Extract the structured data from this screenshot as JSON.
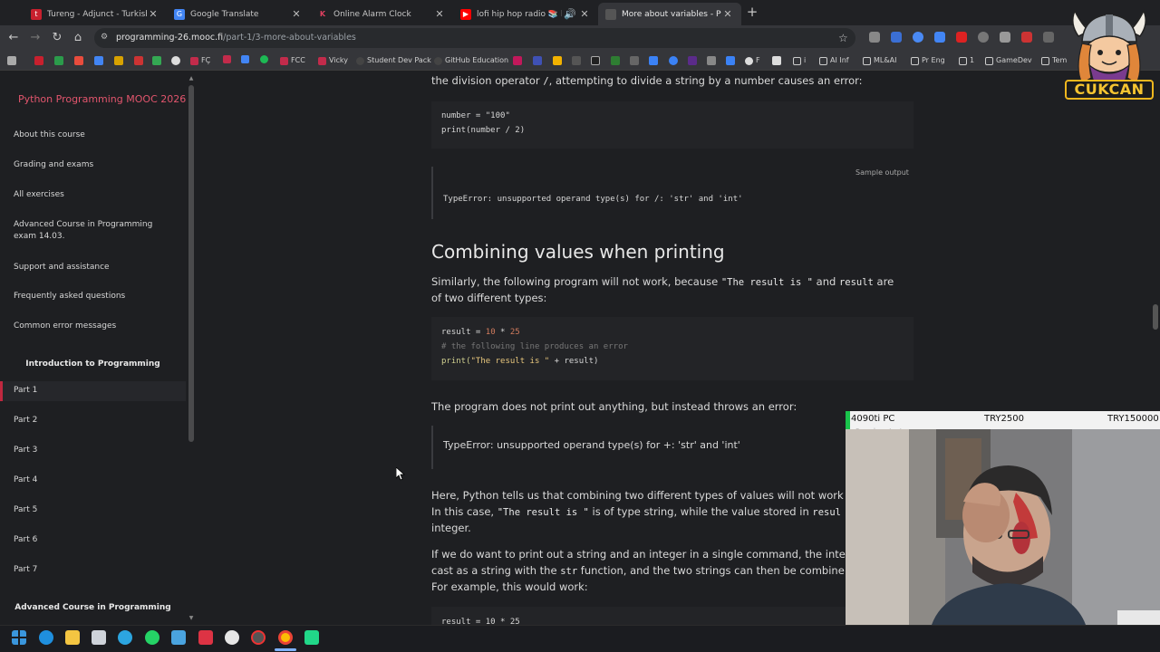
{
  "browser": {
    "tabs": [
      {
        "title": "Tureng - Adjunct - Turkish Eng",
        "color": "#c8202e",
        "icon": "tureng-icon"
      },
      {
        "title": "Google Translate",
        "color": "#4285f4",
        "icon": "translate-icon"
      },
      {
        "title": "Online Alarm Clock",
        "color": "#c22b4b",
        "icon": "alarm-k-icon"
      },
      {
        "title": "lofi hip hop radio 📚 beats",
        "color": "#ff0000",
        "icon": "youtube-icon"
      },
      {
        "title": "More about variables - Python",
        "color": "#444",
        "icon": "mooc-icon"
      }
    ],
    "url_host": "programming-26.mooc.fi",
    "url_path": "/part-1/3-more-about-variables",
    "bookmarks": [
      "FÇ",
      "FCC",
      "Vicky",
      "Student Dev Pack",
      "GitHub Education",
      "F",
      "i",
      "AI Inf",
      "ML&AI",
      "Pr Eng",
      "1",
      "GameDev",
      "Tem"
    ]
  },
  "sidebar": {
    "title": "Python Programming MOOC 2026",
    "items": [
      "About this course",
      "Grading and exams",
      "All exercises",
      "Advanced Course in Programming exam 14.03.",
      "Support and assistance",
      "Frequently asked questions",
      "Common error messages"
    ],
    "section_intro": "Introduction to Programming",
    "parts": [
      "Part 1",
      "Part 2",
      "Part 3",
      "Part 4",
      "Part 5",
      "Part 6",
      "Part 7"
    ],
    "section_advanced": "Advanced Course in Programming"
  },
  "content": {
    "intro_line_pre": "the division operator ",
    "intro_line_op": "/",
    "intro_line_post": ", attempting to divide a string by a number causes an error:",
    "code1_line1": "number = \"100\"",
    "code1_line2": "print(number / 2)",
    "sample_output_label": "Sample output",
    "output1": "TypeError: unsupported operand type(s) for /: 'str' and 'int'",
    "heading": "Combining values when printing",
    "para1_pre": "Similarly, the following program will not work, because ",
    "para1_code1": "\"The result is \"",
    "para1_mid": " and ",
    "para1_code2": "result",
    "para1_post": " are",
    "para1_line2": "of two different types:",
    "code2_line1_a": "result = ",
    "code2_line1_b": "10",
    "code2_line1_c": " * ",
    "code2_line1_d": "25",
    "code2_line2": "# the following line produces an error",
    "code2_line3_a": "print(",
    "code2_line3_b": "\"The result is \"",
    "code2_line3_c": " + result)",
    "para2": "The program does not print out anything, but instead throws an error:",
    "output2": "TypeError: unsupported operand type(s) for +: 'str' and 'int'",
    "para3_line1": "Here, Python tells us that combining two different types of values will not work j",
    "para3_line2_pre": "In this case, ",
    "para3_line2_code": "\"The result is \"",
    "para3_line2_mid": " is of type string, while the value stored in ",
    "para3_line2_code2": "resul",
    "para3_line3": "integer.",
    "para4_line1": "If we do want to print out a string and an integer in a single command, the integ",
    "para4_line2_pre": "cast as a string with the ",
    "para4_line2_code": "str",
    "para4_line2_post": " function, and the two strings can then be combine",
    "para4_line3": "For example, this would work:",
    "code3_partial": "result = 10 * 25"
  },
  "overlay": {
    "label_left": "4090ti PC",
    "label_mid": "TRY2500",
    "label_right": "TRY150000",
    "sub": "Sample output"
  },
  "logo_text": "CUKCAN"
}
